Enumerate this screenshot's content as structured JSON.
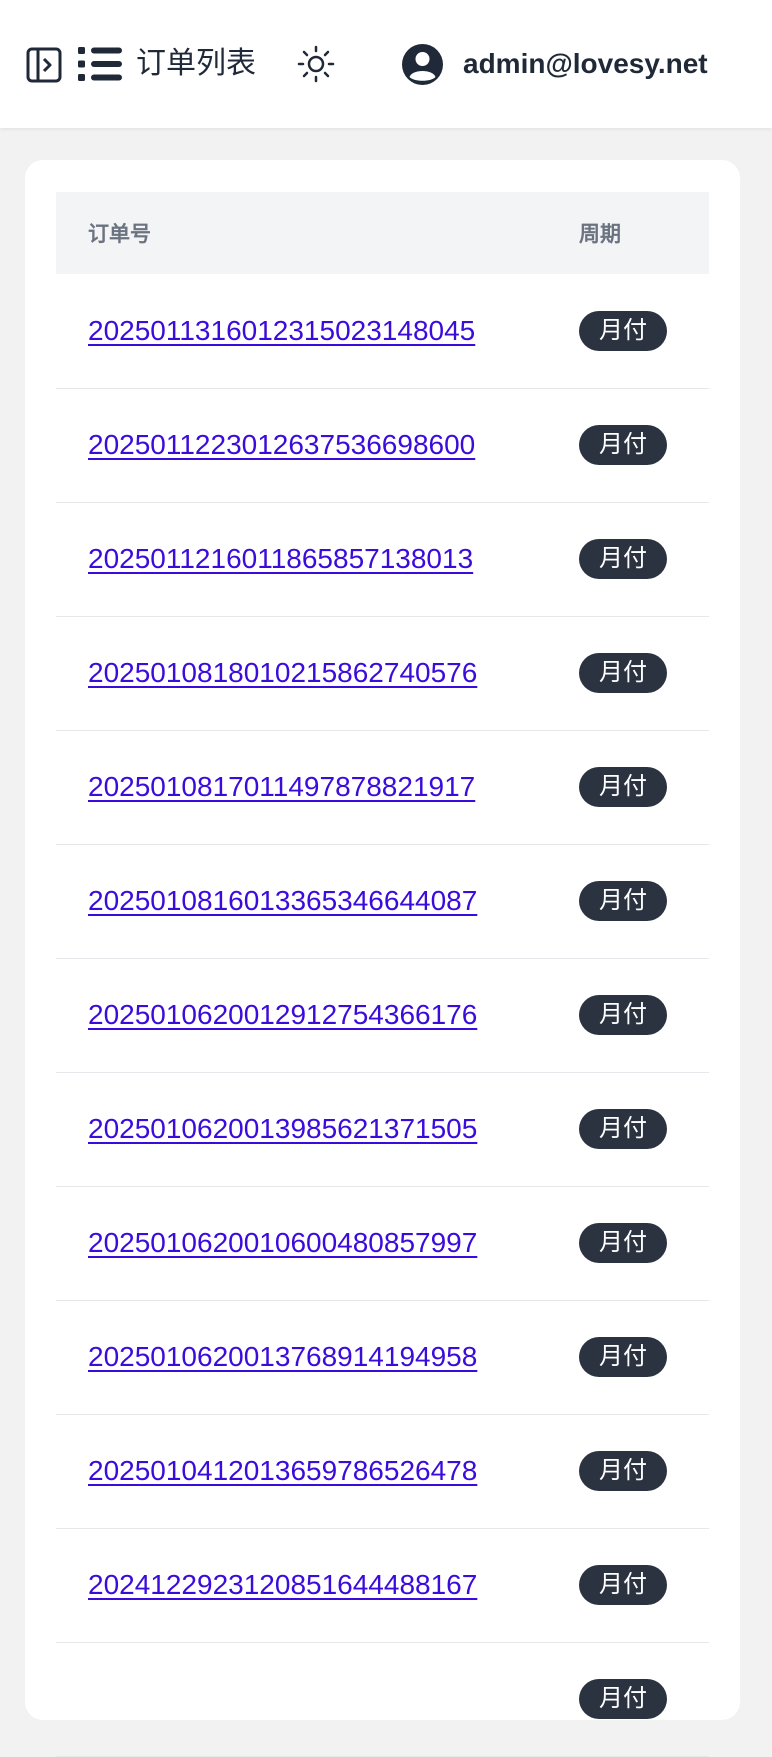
{
  "header": {
    "title": "订单列表",
    "user_email": "admin@lovesy.net"
  },
  "table": {
    "columns": [
      "订单号",
      "周期"
    ],
    "rows": [
      {
        "order_no": "2025011316012315023148045",
        "period": "月付"
      },
      {
        "order_no": "2025011223012637536698600",
        "period": "月付"
      },
      {
        "order_no": "2025011216011865857138013",
        "period": "月付"
      },
      {
        "order_no": "2025010818010215862740576",
        "period": "月付"
      },
      {
        "order_no": "2025010817011497878821917",
        "period": "月付"
      },
      {
        "order_no": "2025010816013365346644087",
        "period": "月付"
      },
      {
        "order_no": "2025010620012912754366176",
        "period": "月付"
      },
      {
        "order_no": "2025010620013985621371505",
        "period": "月付"
      },
      {
        "order_no": "2025010620010600480857997",
        "period": "月付"
      },
      {
        "order_no": "2025010620013768914194958",
        "period": "月付"
      },
      {
        "order_no": "2025010412013659786526478",
        "period": "月付"
      },
      {
        "order_no": "2024122923120851644488167",
        "period": "月付"
      },
      {
        "order_no": "",
        "period": "月付"
      }
    ]
  },
  "colors": {
    "link": "#3b0bdc",
    "badge_bg": "#2b3240",
    "page_bg": "#f2f2f2"
  },
  "icons": [
    "sidebar-toggle-icon",
    "list-icon",
    "sun-icon",
    "user-avatar-icon"
  ]
}
